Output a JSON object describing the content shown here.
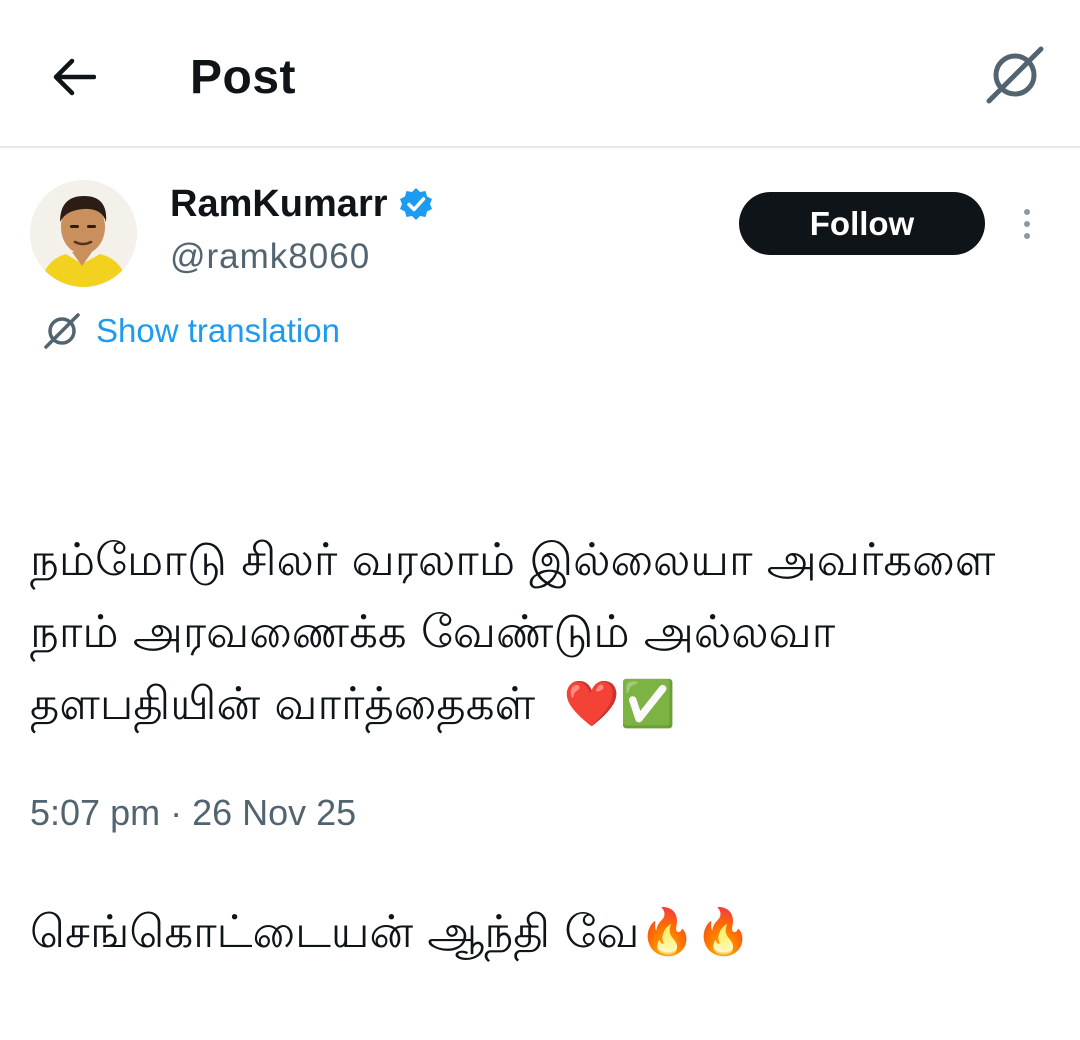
{
  "header": {
    "title": "Post",
    "back_icon": "arrow-left-icon",
    "translate_icon": "translate-icon"
  },
  "author": {
    "display_name": "RamKumarr",
    "handle": "@ramk8060",
    "verified_color": "#1d9bf0",
    "verified_icon": "verified-badge-icon"
  },
  "actions": {
    "follow_label": "Follow",
    "more_icon": "more-vertical-icon"
  },
  "translation": {
    "label": "Show translation",
    "link_color": "#1d9bf0"
  },
  "tweet": {
    "paragraph_1": "நம்மோடு சிலர் வரலாம் இல்லையா அவர்களை நாம் அரவணைக்க வேண்டும் அல்லவா தளபதியின் வார்த்தைகள்  ❤️✅",
    "paragraph_2": "செங்கொட்டையன் ஆந்தி வே🔥🔥"
  },
  "meta": {
    "timestamp": "5:07 pm · 26 Nov 25"
  }
}
